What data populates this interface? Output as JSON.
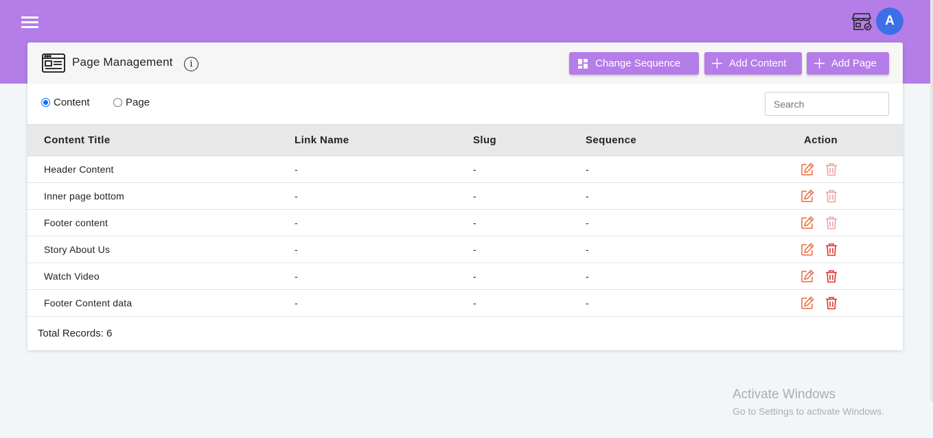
{
  "header": {
    "avatar_letter": "A",
    "brand_color": "#b47de8",
    "avatar_color": "#3d6fe8"
  },
  "card": {
    "title": "Page Management",
    "info_glyph": "i",
    "buttons": {
      "change_sequence": "Change Sequence",
      "add_content": "Add Content",
      "add_page": "Add Page"
    }
  },
  "filters": {
    "options": [
      {
        "label": "Content",
        "selected": true
      },
      {
        "label": "Page",
        "selected": false
      }
    ],
    "search_placeholder": "Search"
  },
  "table": {
    "columns": [
      "Content Title",
      "Link Name",
      "Slug",
      "Sequence",
      "Action"
    ],
    "rows": [
      {
        "title": "Header Content",
        "link_name": "-",
        "slug": "-",
        "sequence": "-",
        "delete_enabled": false
      },
      {
        "title": "Inner page bottom",
        "link_name": "-",
        "slug": "-",
        "sequence": "-",
        "delete_enabled": false
      },
      {
        "title": "Footer content",
        "link_name": "-",
        "slug": "-",
        "sequence": "-",
        "delete_enabled": false
      },
      {
        "title": "Story About Us",
        "link_name": "-",
        "slug": "-",
        "sequence": "-",
        "delete_enabled": true
      },
      {
        "title": "Watch Video",
        "link_name": "-",
        "slug": "-",
        "sequence": "-",
        "delete_enabled": true
      },
      {
        "title": "Footer Content data",
        "link_name": "-",
        "slug": "-",
        "sequence": "-",
        "delete_enabled": true
      }
    ]
  },
  "footer": {
    "total_records": "Total Records: 6"
  },
  "watermark": {
    "line1": "Activate Windows",
    "line2": "Go to Settings to activate Windows."
  },
  "icons": {
    "edit": "edit-icon",
    "delete": "trash-icon",
    "edit_color": "#e8683d",
    "delete_color": "#e0322f"
  }
}
